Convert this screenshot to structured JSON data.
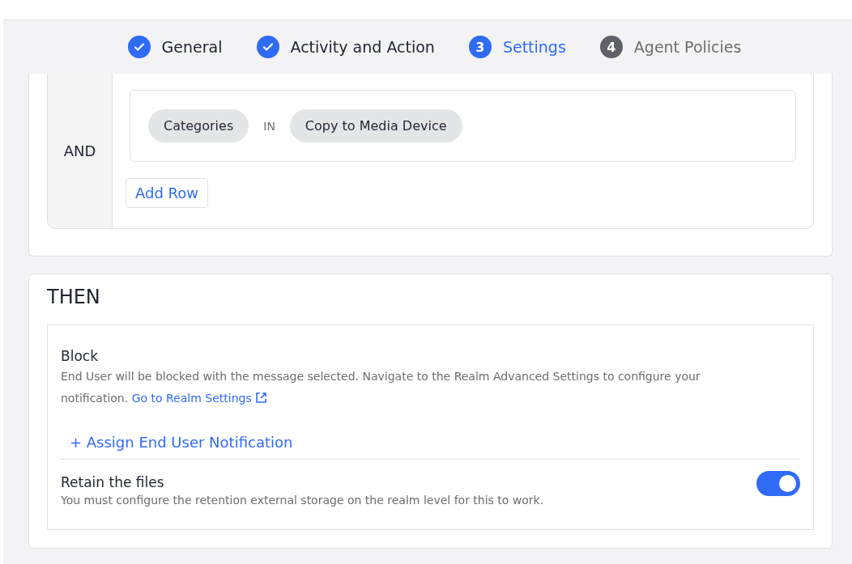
{
  "steps": [
    {
      "label": "General",
      "completed": true,
      "selected": false
    },
    {
      "label": "Activity and Action",
      "completed": true,
      "selected": false
    },
    {
      "number": "3",
      "label": "Settings",
      "completed": false,
      "selected": true
    },
    {
      "number": "4",
      "label": "Agent Policies",
      "completed": false,
      "selected": false
    }
  ],
  "condition": {
    "operator": "AND",
    "rows": [
      {
        "field": "Categories",
        "comparator": "IN",
        "value": "Copy to Media Device"
      }
    ],
    "add_row": "Add Row"
  },
  "then": {
    "title": "THEN",
    "action": {
      "title": "Block",
      "description": "End User will be blocked with the message selected. Navigate to the Realm Advanced Settings to configure your notification.",
      "link": "Go to Realm Settings",
      "assign": "+ Assign End User Notification"
    },
    "retain": {
      "title": "Retain the files",
      "description": "You must configure the retention external storage on the realm level for this to work.",
      "on": true
    }
  }
}
